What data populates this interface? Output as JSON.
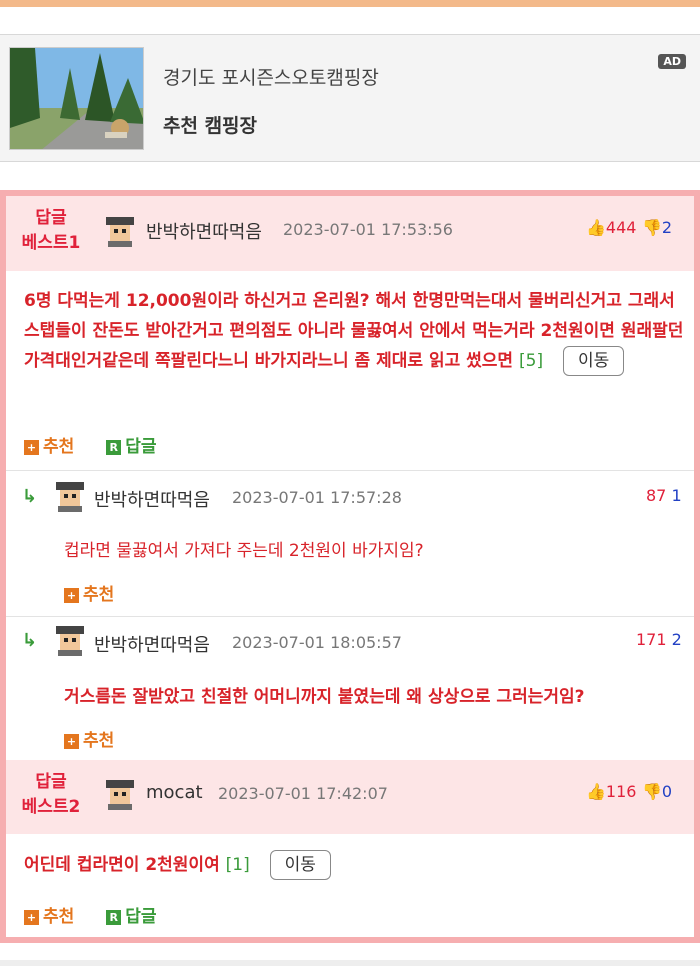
{
  "ad": {
    "badge": "AD",
    "title": "경기도 포시즌스오토캠핑장",
    "subtitle": "추천 캠핑장"
  },
  "best1": {
    "label_line1": "답글",
    "label_line2": "베스트1",
    "nick": "반박하면따먹음",
    "time": "2023-07-01 17:53:56",
    "up_count": "444",
    "down_count": "2",
    "text": "6명 다먹는게 12,000원이라 하신거고 온리원? 해서 한명만먹는대서 물버리신거고 그래서 스탭들이 잔돈도 받아간거고 편의점도 아니라 물끓여서 안에서 먹는거라 2천원이면 원래팔던가격대인거같은데 쪽팔린다느니 바가지라느니 좀 제대로 읽고 썼으면",
    "reply_count": "[5]",
    "move_label": "이동",
    "recommend_label": "추천",
    "reply_label": "답글",
    "recommend_icon": "+",
    "reply_icon": "R"
  },
  "replies": [
    {
      "nick": "반박하면따먹음",
      "time": "2023-07-01 17:57:28",
      "up": "87",
      "down": "1",
      "text": "컵라면 물끓여서 가져다 주는데 2천원이 바가지임?",
      "recommend_label": "추천",
      "recommend_icon": "+"
    },
    {
      "nick": "반박하면따먹음",
      "time": "2023-07-01 18:05:57",
      "up": "171",
      "down": "2",
      "text": "거스름돈 잘받았고 친절한 어머니까지 붙였는데 왜 상상으로 그러는거임?",
      "recommend_label": "추천",
      "recommend_icon": "+"
    }
  ],
  "best2": {
    "label_line1": "답글",
    "label_line2": "베스트2",
    "nick": "mocat",
    "time": "2023-07-01 17:42:07",
    "up_count": "116",
    "down_count": "0",
    "text": "어딘데 컵라면이 2천원이여",
    "reply_count": "[1]",
    "move_label": "이동",
    "recommend_label": "추천",
    "reply_label": "답글",
    "recommend_icon": "+",
    "reply_icon": "R"
  },
  "icons": {
    "thumb_up": "thumbs-up-icon",
    "thumb_down": "thumbs-down-icon",
    "reply_arrow": "reply-arrow-icon"
  },
  "colors": {
    "best_border": "#f6aeb0",
    "best_header_bg": "#fde5e6",
    "best_label": "#e0213a",
    "body_text": "#d8232a",
    "recommend": "#e4761e",
    "reply_green": "#3a9b3a",
    "down_blue": "#2241c4"
  }
}
